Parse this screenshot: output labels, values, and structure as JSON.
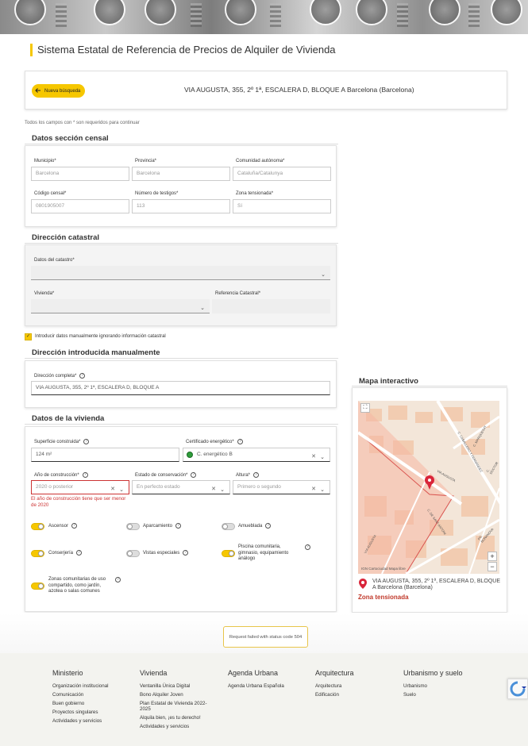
{
  "page_title": "Sistema Estatal de Referencia de Precios de Alquiler de Vivienda",
  "search": {
    "button_label": "Nueva búsqueda",
    "address": "VIA AUGUSTA, 355, 2º 1ª, ESCALERA D, BLOQUE A Barcelona (Barcelona)"
  },
  "required_note": "Todos los campos con * son requeridos para continuar",
  "censal": {
    "title": "Datos sección censal",
    "municipio_label": "Municipio*",
    "municipio_value": "Barcelona",
    "provincia_label": "Provincia*",
    "provincia_value": "Barcelona",
    "comunidad_label": "Comunidad autónoma*",
    "comunidad_value": "Cataluña/Catalunya",
    "codigo_label": "Código censal*",
    "codigo_value": "0801905007",
    "testigos_label": "Número de testigos*",
    "testigos_value": "113",
    "zona_label": "Zona tensionada*",
    "zona_value": "Sí"
  },
  "catastral": {
    "title": "Dirección catastral",
    "datos_label": "Datos del catastro*",
    "datos_value": "",
    "vivienda_label": "Vivienda*",
    "vivienda_value": "",
    "referencia_label": "Referencia Catastral*",
    "referencia_value": ""
  },
  "manual_checkbox_label": "Introducir datos manualmente ignorando información catastral",
  "manual": {
    "title": "Dirección introducida manualmente",
    "direccion_label": "Dirección completa*",
    "direccion_value": "VIA AUGUSTA, 355, 2º 1ª, ESCALERA D, BLOQUE A"
  },
  "vivienda": {
    "title": "Datos de la vivienda",
    "superficie_label": "Superficie construida*",
    "superficie_value": "124  m²",
    "certificado_label": "Certificado energético*",
    "certificado_value": "C. energético B",
    "anio_label": "Año de construcción*",
    "anio_value": "2020 o posterior",
    "anio_error": "El año de construcción tiene que ser menor de 2020",
    "estado_label": "Estado de conservación*",
    "estado_value": "En perfecto estado",
    "altura_label": "Altura*",
    "altura_value": "Primero o segundo",
    "toggles": [
      {
        "label": "Ascensor",
        "on": true
      },
      {
        "label": "Aparcamiento",
        "on": false
      },
      {
        "label": "Amueblada",
        "on": false
      },
      {
        "label": "Conserjería",
        "on": true
      },
      {
        "label": "Vistas especiales",
        "on": false
      },
      {
        "label": "Piscina comunitaria, gimnasio, equipamiento análogo",
        "on": true
      },
      {
        "label": "Zonas comunitarias de uso compartido, como jardín, azotea o salas comunes",
        "on": true
      }
    ]
  },
  "map": {
    "title": "Mapa interactivo",
    "address": "VIA AUGUSTA, 355, 2º 1ª, ESCALERA D, BLOQUE A Barcelona (Barcelona)",
    "zone": "Zona tensionada",
    "attribution": "IGN  Cartociudad  Mapa libre",
    "streets": [
      "C. MARQUESAT",
      "C. CABALLERO Y FERNÁNDEZ",
      "C. DOCTOR",
      "VIA AUGUSTA",
      "C. DE SANT ANTONI",
      "PG. BONANOVA",
      "VIA AUGUSTA"
    ],
    "zoom_in": "+",
    "zoom_out": "−"
  },
  "toast": "Request failed with status code 504",
  "footer": [
    {
      "head": "Ministerio",
      "links": [
        "Organización institucional",
        "Comunicación",
        "Buen gobierno",
        "Proyectos singulares",
        "Actividades y servicios"
      ]
    },
    {
      "head": "Vivienda",
      "links": [
        "Ventanilla Única Digital",
        "Bono Alquiler Joven",
        "Plan Estatal de Vivienda 2022-2025",
        "Alquila bien, ¡es tu derecho!",
        "Actividades y servicios"
      ]
    },
    {
      "head": "Agenda Urbana",
      "links": [
        "Agenda Urbana Española"
      ]
    },
    {
      "head": "Arquitectura",
      "links": [
        "Arquitectura",
        "Edificación"
      ]
    },
    {
      "head": "Urbanismo y suelo",
      "links": [
        "Urbanismo",
        "Suelo"
      ]
    }
  ],
  "colors": {
    "accent": "#f6c700",
    "error": "#c33333",
    "zone_red": "#c0392b",
    "map_bg": "#f6e8dc"
  }
}
